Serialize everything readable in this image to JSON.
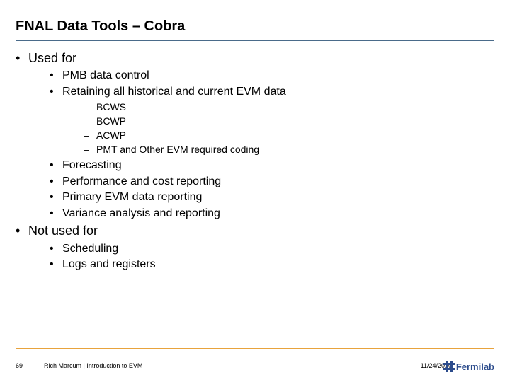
{
  "title": "FNAL Data Tools – Cobra",
  "sections": [
    {
      "heading": "Used for",
      "items": [
        {
          "text": "PMB data control"
        },
        {
          "text": "Retaining all historical and current EVM data",
          "sub": [
            "BCWS",
            "BCWP",
            "ACWP",
            "PMT and Other EVM required coding"
          ]
        },
        {
          "text": "Forecasting"
        },
        {
          "text": "Performance and cost reporting"
        },
        {
          "text": "Primary EVM data reporting"
        },
        {
          "text": "Variance analysis and reporting"
        }
      ]
    },
    {
      "heading": "Not used for",
      "items": [
        {
          "text": "Scheduling"
        },
        {
          "text": "Logs and registers"
        }
      ]
    }
  ],
  "footer": {
    "page": "69",
    "presenter": "Rich Marcum | Introduction to EVM",
    "date": "11/24/2020",
    "logo_text": "Fermilab"
  }
}
